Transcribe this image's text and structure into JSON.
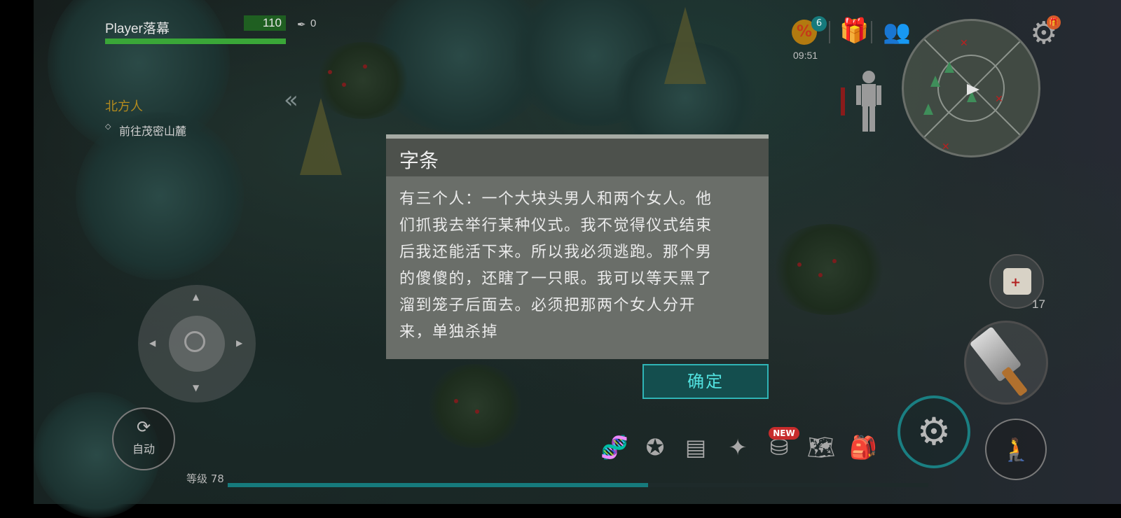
{
  "player": {
    "name": "Player落幕",
    "health": "110",
    "kills": "0"
  },
  "quest": {
    "title": "北方人",
    "task": "前往茂密山麓"
  },
  "dialog": {
    "title": "字条",
    "lines": [
      "有三个人：一个大块头男人和两个女人。他",
      "们抓我去举行某种仪式。我不觉得仪式结束",
      "后我还能活下来。所以我必须逃跑。那个男",
      "的傻傻的，还瞎了一只眼。我可以等天黑了",
      "溜到笼子后面去。必须把那两个女人分开",
      "来，单独杀掉"
    ],
    "confirm_label": "确定"
  },
  "hud": {
    "auto_label": "自动",
    "level_label": "等级 78",
    "xp_progress": 0.6,
    "discount_badge": "6",
    "timer": "09:51",
    "medkit_count": "17",
    "new_badge": "NEW",
    "settings_badge": "🎁"
  },
  "colors": {
    "accent": "#2fb4b6",
    "health": "#3aa638",
    "quest": "#b28a1e",
    "dialog_bg": "#6a6e69"
  },
  "icons": {
    "bottom_menu": [
      "dna-icon",
      "clan-icon",
      "journal-icon",
      "compass-icon",
      "coins-icon",
      "map-icon",
      "backpack-icon"
    ]
  }
}
